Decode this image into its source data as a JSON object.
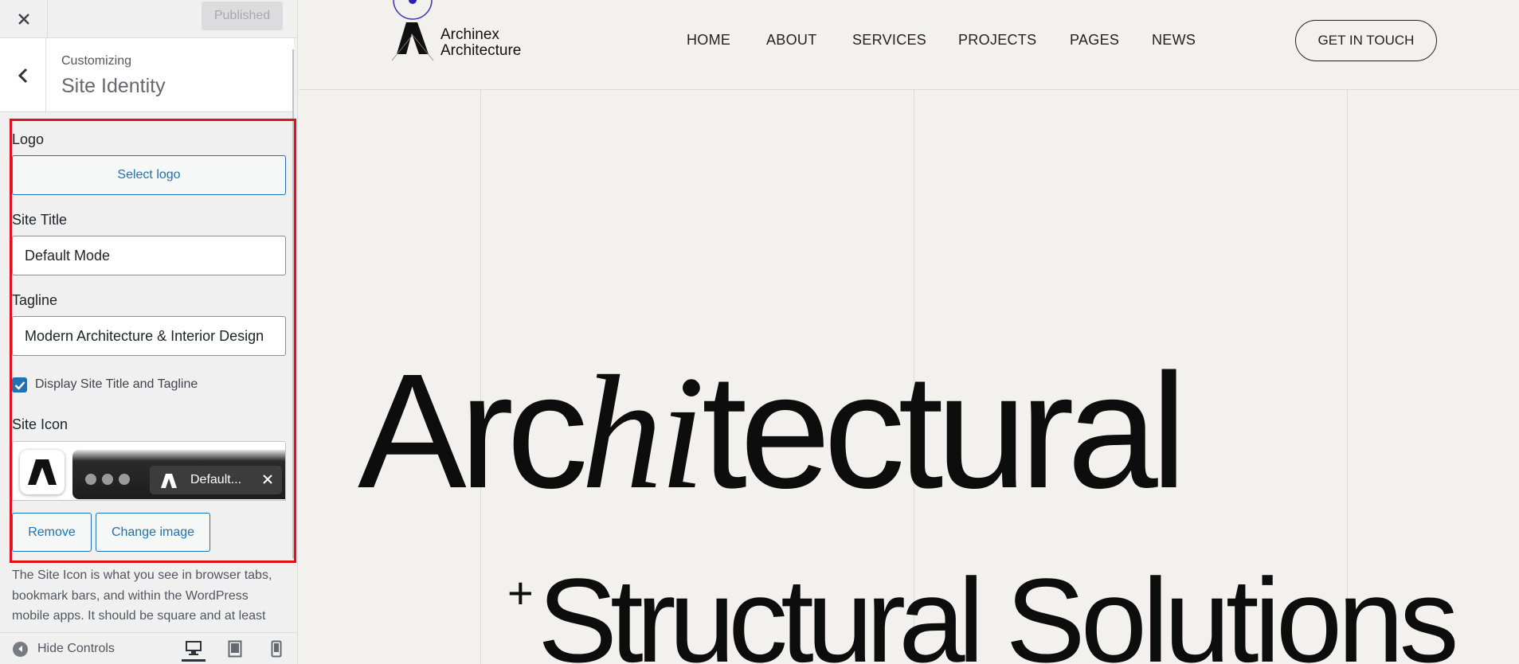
{
  "sidebar": {
    "published_label": "Published",
    "customizing_label": "Customizing",
    "section_title": "Site Identity",
    "logo": {
      "label": "Logo",
      "button": "Select logo"
    },
    "site_title": {
      "label": "Site Title",
      "value": "Default Mode"
    },
    "tagline": {
      "label": "Tagline",
      "value": "Modern Architecture & Interior Design"
    },
    "display_checkbox": {
      "label": "Display Site Title and Tagline",
      "checked": true
    },
    "site_icon": {
      "label": "Site Icon",
      "tab_text": "Default...",
      "remove_button": "Remove",
      "change_button": "Change image"
    },
    "description": "The Site Icon is what you see in browser tabs, bookmark bars, and within the WordPress mobile apps. It should be square and at least",
    "footer": {
      "hide_controls": "Hide Controls",
      "active_device": "desktop"
    },
    "accent_color": "#2271b1",
    "highlight_color": "#e3101a"
  },
  "site": {
    "brand": {
      "line1": "Archinex",
      "line2": "Architecture"
    },
    "nav": [
      "HOME",
      "ABOUT",
      "SERVICES",
      "PROJECTS",
      "PAGES",
      "NEWS"
    ],
    "cta": "GET IN TOUCH",
    "hero": {
      "line1_a": "Arc",
      "line1_b": "hi",
      "line1_c": "tectural",
      "plus": "+",
      "line2_a": "Structural",
      "line2_b": "Solutions"
    }
  }
}
